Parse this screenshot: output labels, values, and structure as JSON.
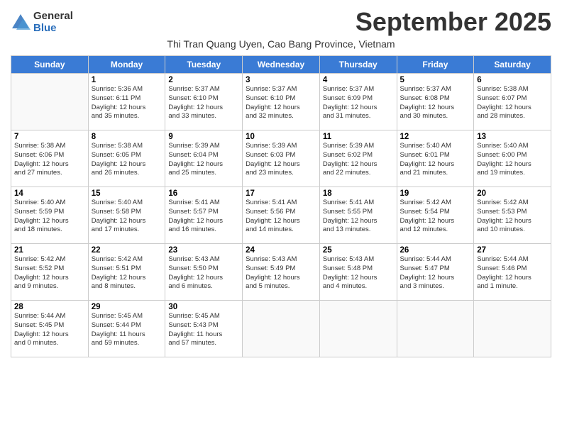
{
  "logo": {
    "general": "General",
    "blue": "Blue"
  },
  "title": "September 2025",
  "subtitle": "Thi Tran Quang Uyen, Cao Bang Province, Vietnam",
  "headers": [
    "Sunday",
    "Monday",
    "Tuesday",
    "Wednesday",
    "Thursday",
    "Friday",
    "Saturday"
  ],
  "weeks": [
    [
      {
        "day": "",
        "info": ""
      },
      {
        "day": "1",
        "info": "Sunrise: 5:36 AM\nSunset: 6:11 PM\nDaylight: 12 hours\nand 35 minutes."
      },
      {
        "day": "2",
        "info": "Sunrise: 5:37 AM\nSunset: 6:10 PM\nDaylight: 12 hours\nand 33 minutes."
      },
      {
        "day": "3",
        "info": "Sunrise: 5:37 AM\nSunset: 6:10 PM\nDaylight: 12 hours\nand 32 minutes."
      },
      {
        "day": "4",
        "info": "Sunrise: 5:37 AM\nSunset: 6:09 PM\nDaylight: 12 hours\nand 31 minutes."
      },
      {
        "day": "5",
        "info": "Sunrise: 5:37 AM\nSunset: 6:08 PM\nDaylight: 12 hours\nand 30 minutes."
      },
      {
        "day": "6",
        "info": "Sunrise: 5:38 AM\nSunset: 6:07 PM\nDaylight: 12 hours\nand 28 minutes."
      }
    ],
    [
      {
        "day": "7",
        "info": "Sunrise: 5:38 AM\nSunset: 6:06 PM\nDaylight: 12 hours\nand 27 minutes."
      },
      {
        "day": "8",
        "info": "Sunrise: 5:38 AM\nSunset: 6:05 PM\nDaylight: 12 hours\nand 26 minutes."
      },
      {
        "day": "9",
        "info": "Sunrise: 5:39 AM\nSunset: 6:04 PM\nDaylight: 12 hours\nand 25 minutes."
      },
      {
        "day": "10",
        "info": "Sunrise: 5:39 AM\nSunset: 6:03 PM\nDaylight: 12 hours\nand 23 minutes."
      },
      {
        "day": "11",
        "info": "Sunrise: 5:39 AM\nSunset: 6:02 PM\nDaylight: 12 hours\nand 22 minutes."
      },
      {
        "day": "12",
        "info": "Sunrise: 5:40 AM\nSunset: 6:01 PM\nDaylight: 12 hours\nand 21 minutes."
      },
      {
        "day": "13",
        "info": "Sunrise: 5:40 AM\nSunset: 6:00 PM\nDaylight: 12 hours\nand 19 minutes."
      }
    ],
    [
      {
        "day": "14",
        "info": "Sunrise: 5:40 AM\nSunset: 5:59 PM\nDaylight: 12 hours\nand 18 minutes."
      },
      {
        "day": "15",
        "info": "Sunrise: 5:40 AM\nSunset: 5:58 PM\nDaylight: 12 hours\nand 17 minutes."
      },
      {
        "day": "16",
        "info": "Sunrise: 5:41 AM\nSunset: 5:57 PM\nDaylight: 12 hours\nand 16 minutes."
      },
      {
        "day": "17",
        "info": "Sunrise: 5:41 AM\nSunset: 5:56 PM\nDaylight: 12 hours\nand 14 minutes."
      },
      {
        "day": "18",
        "info": "Sunrise: 5:41 AM\nSunset: 5:55 PM\nDaylight: 12 hours\nand 13 minutes."
      },
      {
        "day": "19",
        "info": "Sunrise: 5:42 AM\nSunset: 5:54 PM\nDaylight: 12 hours\nand 12 minutes."
      },
      {
        "day": "20",
        "info": "Sunrise: 5:42 AM\nSunset: 5:53 PM\nDaylight: 12 hours\nand 10 minutes."
      }
    ],
    [
      {
        "day": "21",
        "info": "Sunrise: 5:42 AM\nSunset: 5:52 PM\nDaylight: 12 hours\nand 9 minutes."
      },
      {
        "day": "22",
        "info": "Sunrise: 5:42 AM\nSunset: 5:51 PM\nDaylight: 12 hours\nand 8 minutes."
      },
      {
        "day": "23",
        "info": "Sunrise: 5:43 AM\nSunset: 5:50 PM\nDaylight: 12 hours\nand 6 minutes."
      },
      {
        "day": "24",
        "info": "Sunrise: 5:43 AM\nSunset: 5:49 PM\nDaylight: 12 hours\nand 5 minutes."
      },
      {
        "day": "25",
        "info": "Sunrise: 5:43 AM\nSunset: 5:48 PM\nDaylight: 12 hours\nand 4 minutes."
      },
      {
        "day": "26",
        "info": "Sunrise: 5:44 AM\nSunset: 5:47 PM\nDaylight: 12 hours\nand 3 minutes."
      },
      {
        "day": "27",
        "info": "Sunrise: 5:44 AM\nSunset: 5:46 PM\nDaylight: 12 hours\nand 1 minute."
      }
    ],
    [
      {
        "day": "28",
        "info": "Sunrise: 5:44 AM\nSunset: 5:45 PM\nDaylight: 12 hours\nand 0 minutes."
      },
      {
        "day": "29",
        "info": "Sunrise: 5:45 AM\nSunset: 5:44 PM\nDaylight: 11 hours\nand 59 minutes."
      },
      {
        "day": "30",
        "info": "Sunrise: 5:45 AM\nSunset: 5:43 PM\nDaylight: 11 hours\nand 57 minutes."
      },
      {
        "day": "",
        "info": ""
      },
      {
        "day": "",
        "info": ""
      },
      {
        "day": "",
        "info": ""
      },
      {
        "day": "",
        "info": ""
      }
    ]
  ]
}
